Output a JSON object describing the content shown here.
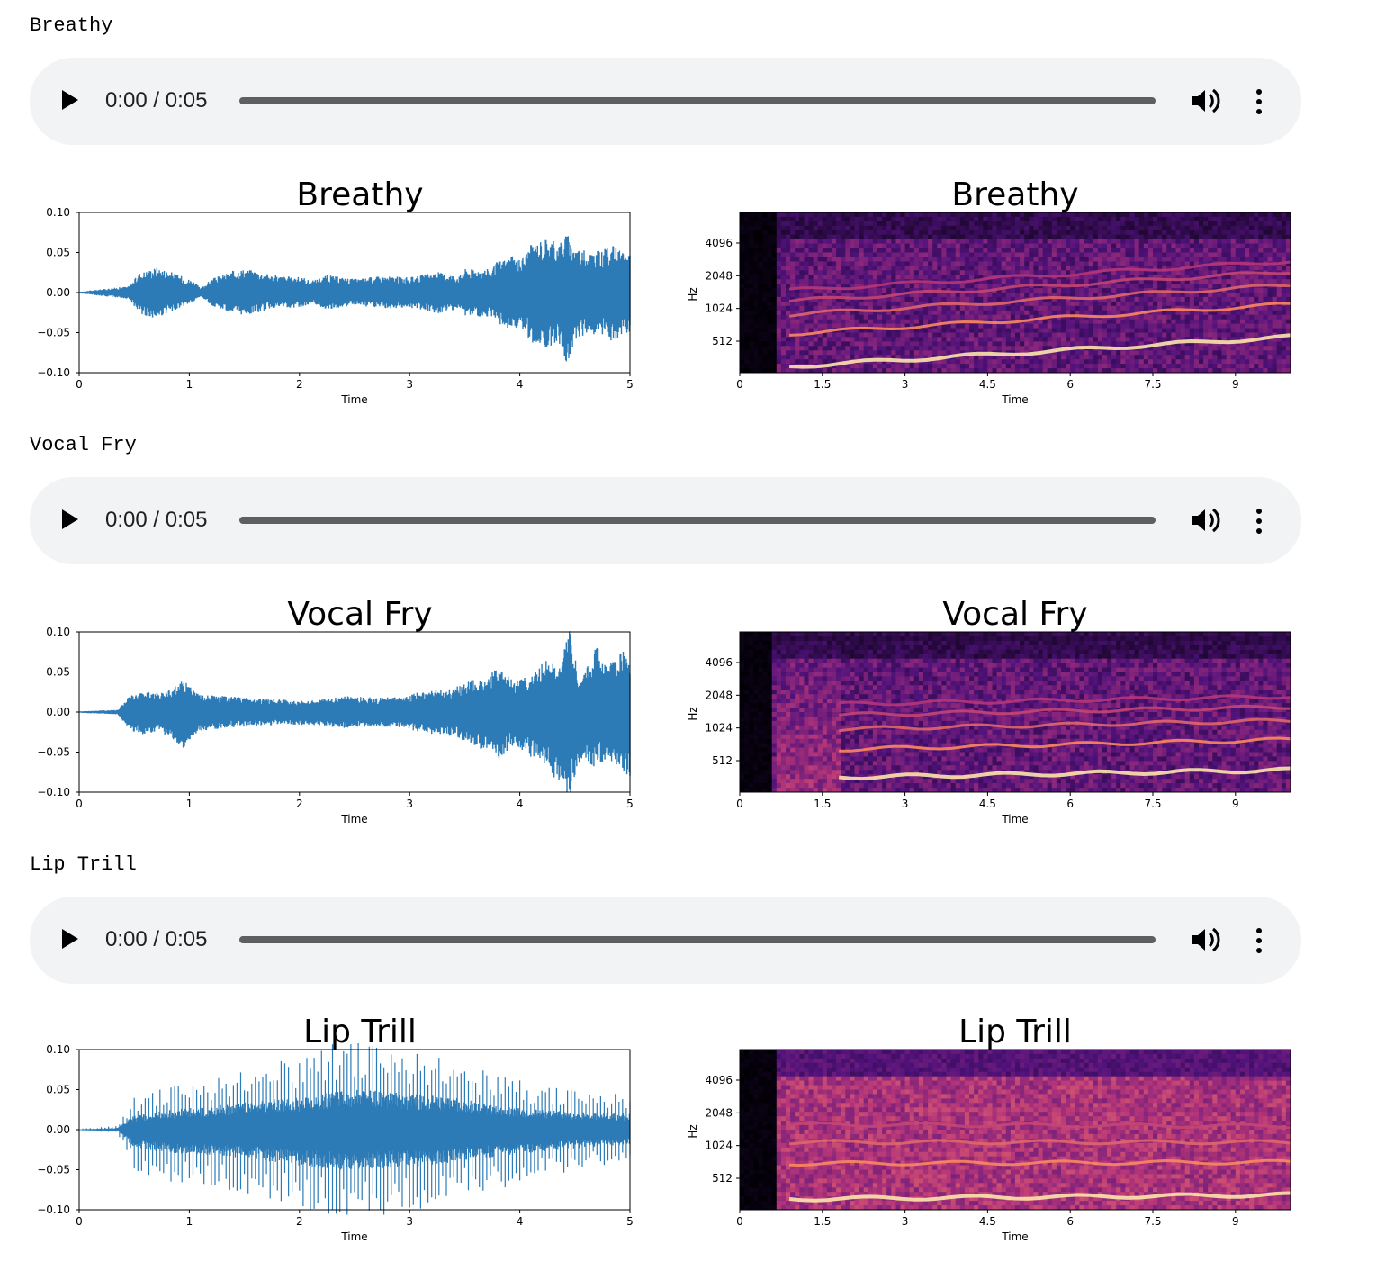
{
  "sections": [
    {
      "label": "Breathy",
      "player": {
        "time": "0:00 / 0:05",
        "progress": 0
      },
      "waveform": {
        "title": "Breathy",
        "xlabel": "Time"
      },
      "spectrogram": {
        "title": "Breathy",
        "xlabel": "Time",
        "ylabel": "Hz"
      }
    },
    {
      "label": "Vocal Fry",
      "player": {
        "time": "0:00 / 0:05",
        "progress": 0
      },
      "waveform": {
        "title": "Vocal Fry",
        "xlabel": "Time"
      },
      "spectrogram": {
        "title": "Vocal Fry",
        "xlabel": "Time",
        "ylabel": "Hz"
      }
    },
    {
      "label": "Lip Trill",
      "player": {
        "time": "0:00 / 0:05",
        "progress": 0
      },
      "waveform": {
        "title": "Lip Trill",
        "xlabel": "Time"
      },
      "spectrogram": {
        "title": "Lip Trill",
        "xlabel": "Time",
        "ylabel": "Hz"
      }
    }
  ],
  "icons": {
    "play": "play-icon",
    "volume": "volume-icon",
    "menu": "more-vert-icon"
  },
  "colors": {
    "waveform": "#2c7bb6",
    "player_bg": "#f1f3f4"
  },
  "chart_data": [
    {
      "type": "area",
      "title": "Breathy",
      "xlabel": "Time",
      "ylabel": "",
      "xlim": [
        0,
        5
      ],
      "ylim": [
        -0.1,
        0.1
      ],
      "xticks": [
        "0",
        "1",
        "2",
        "3",
        "4",
        "5"
      ],
      "yticks": [
        "0.10",
        "0.05",
        "0.00",
        "−0.05",
        "−0.10"
      ],
      "envelope": {
        "x": [
          0,
          0.45,
          0.55,
          0.7,
          0.8,
          1.05,
          1.1,
          1.2,
          1.45,
          1.6,
          1.75,
          1.9,
          2.05,
          2.1,
          2.25,
          2.5,
          2.75,
          3.0,
          3.25,
          3.45,
          3.5,
          3.75,
          3.8,
          3.95,
          4.0,
          4.1,
          4.25,
          4.35,
          4.42,
          4.5,
          4.6,
          4.75,
          4.85,
          4.95,
          5.0
        ],
        "pos": [
          0.001,
          0.008,
          0.025,
          0.032,
          0.028,
          0.014,
          0.005,
          0.017,
          0.03,
          0.028,
          0.022,
          0.02,
          0.019,
          0.014,
          0.022,
          0.017,
          0.021,
          0.019,
          0.026,
          0.021,
          0.03,
          0.03,
          0.04,
          0.046,
          0.04,
          0.06,
          0.07,
          0.062,
          0.074,
          0.06,
          0.052,
          0.053,
          0.06,
          0.048,
          0.055
        ],
        "neg": [
          0.001,
          0.008,
          0.026,
          0.034,
          0.026,
          0.012,
          0.005,
          0.016,
          0.029,
          0.026,
          0.02,
          0.019,
          0.018,
          0.013,
          0.021,
          0.016,
          0.02,
          0.019,
          0.026,
          0.021,
          0.03,
          0.03,
          0.04,
          0.048,
          0.04,
          0.062,
          0.07,
          0.064,
          0.092,
          0.06,
          0.052,
          0.053,
          0.062,
          0.048,
          0.055
        ]
      }
    },
    {
      "type": "heatmap",
      "title": "Breathy",
      "xlabel": "Time",
      "ylabel": "Hz",
      "xlim": [
        0,
        10
      ],
      "xticks": [
        "0",
        "1.5",
        "3",
        "4.5",
        "6",
        "7.5",
        "9"
      ],
      "yticks": [
        "512",
        "1024",
        "2048",
        "4096"
      ],
      "scale": "log",
      "harmonics": [
        {
          "start": [
            0.9,
            300
          ],
          "end": [
            10.0,
            560
          ]
        },
        {
          "start": [
            0.9,
            600
          ],
          "end": [
            10.0,
            1120
          ]
        },
        {
          "start": [
            0.9,
            900
          ],
          "end": [
            10.0,
            1680
          ]
        },
        {
          "start": [
            0.9,
            1200
          ],
          "end": [
            10.0,
            2240
          ]
        },
        {
          "start": [
            0.9,
            1500
          ],
          "end": [
            10.0,
            2800
          ]
        }
      ]
    },
    {
      "type": "area",
      "title": "Vocal Fry",
      "xlabel": "Time",
      "ylabel": "",
      "xlim": [
        0,
        5
      ],
      "ylim": [
        -0.1,
        0.1
      ],
      "xticks": [
        "0",
        "1",
        "2",
        "3",
        "4",
        "5"
      ],
      "yticks": [
        "0.10",
        "0.05",
        "0.00",
        "−0.05",
        "−0.10"
      ],
      "envelope": {
        "x": [
          0,
          0.35,
          0.45,
          0.6,
          0.75,
          0.95,
          1.1,
          1.3,
          1.55,
          1.8,
          2.1,
          2.4,
          2.7,
          2.95,
          3.1,
          3.4,
          3.55,
          3.7,
          3.8,
          3.95,
          4.1,
          4.25,
          4.35,
          4.45,
          4.55,
          4.7,
          4.8,
          4.95,
          5.0
        ],
        "pos": [
          0.001,
          0.003,
          0.02,
          0.026,
          0.024,
          0.04,
          0.022,
          0.02,
          0.018,
          0.016,
          0.014,
          0.02,
          0.018,
          0.019,
          0.026,
          0.03,
          0.04,
          0.042,
          0.058,
          0.04,
          0.048,
          0.07,
          0.052,
          0.104,
          0.04,
          0.084,
          0.06,
          0.078,
          0.08
        ],
        "neg": [
          0.001,
          0.003,
          0.022,
          0.03,
          0.026,
          0.046,
          0.024,
          0.02,
          0.018,
          0.016,
          0.016,
          0.02,
          0.018,
          0.019,
          0.026,
          0.03,
          0.04,
          0.05,
          0.06,
          0.04,
          0.056,
          0.068,
          0.09,
          0.106,
          0.06,
          0.07,
          0.056,
          0.08,
          0.08
        ]
      }
    },
    {
      "type": "heatmap",
      "title": "Vocal Fry",
      "xlabel": "Time",
      "ylabel": "Hz",
      "xlim": [
        0,
        10
      ],
      "xticks": [
        "0",
        "1.5",
        "3",
        "4.5",
        "6",
        "7.5",
        "9"
      ],
      "yticks": [
        "512",
        "1024",
        "2048",
        "4096"
      ],
      "scale": "log",
      "harmonics": [
        {
          "start": [
            1.8,
            360
          ],
          "end": [
            10.0,
            420
          ]
        },
        {
          "start": [
            1.8,
            650
          ],
          "end": [
            10.0,
            800
          ]
        },
        {
          "start": [
            1.8,
            1000
          ],
          "end": [
            10.0,
            1200
          ]
        },
        {
          "start": [
            1.8,
            1350
          ],
          "end": [
            10.0,
            1600
          ]
        },
        {
          "start": [
            1.8,
            1700
          ],
          "end": [
            10.0,
            2000
          ]
        }
      ]
    },
    {
      "type": "area",
      "title": "Lip Trill",
      "xlabel": "Time",
      "ylabel": "",
      "xlim": [
        0,
        5
      ],
      "ylim": [
        -0.1,
        0.1
      ],
      "xticks": [
        "0",
        "1",
        "2",
        "3",
        "4",
        "5"
      ],
      "yticks": [
        "0.10",
        "0.05",
        "0.00",
        "−0.05",
        "−0.10"
      ],
      "envelope": {
        "x": [
          0,
          0.35,
          0.5,
          0.8,
          1.2,
          1.6,
          2.0,
          2.4,
          2.6,
          3.0,
          3.4,
          3.8,
          4.2,
          4.6,
          5.0
        ],
        "pos": [
          0.001,
          0.005,
          0.04,
          0.055,
          0.065,
          0.08,
          0.09,
          0.112,
          0.11,
          0.1,
          0.09,
          0.07,
          0.055,
          0.048,
          0.045
        ],
        "neg": [
          0.001,
          0.005,
          0.05,
          0.065,
          0.07,
          0.085,
          0.1,
          0.115,
          0.11,
          0.105,
          0.09,
          0.075,
          0.06,
          0.05,
          0.04
        ]
      }
    },
    {
      "type": "heatmap",
      "title": "Lip Trill",
      "xlabel": "Time",
      "ylabel": "Hz",
      "xlim": [
        0,
        10
      ],
      "xticks": [
        "0",
        "1.5",
        "3",
        "4.5",
        "6",
        "7.5",
        "9"
      ],
      "yticks": [
        "512",
        "1024",
        "2048",
        "4096"
      ],
      "scale": "log",
      "harmonics": [
        {
          "start": [
            0.9,
            330
          ],
          "end": [
            10.0,
            360
          ]
        },
        {
          "start": [
            0.9,
            700
          ],
          "end": [
            10.0,
            720
          ]
        },
        {
          "start": [
            0.9,
            1100
          ],
          "end": [
            10.0,
            1100
          ]
        },
        {
          "start": [
            0.9,
            1600
          ],
          "end": [
            10.0,
            1550
          ]
        }
      ]
    }
  ]
}
